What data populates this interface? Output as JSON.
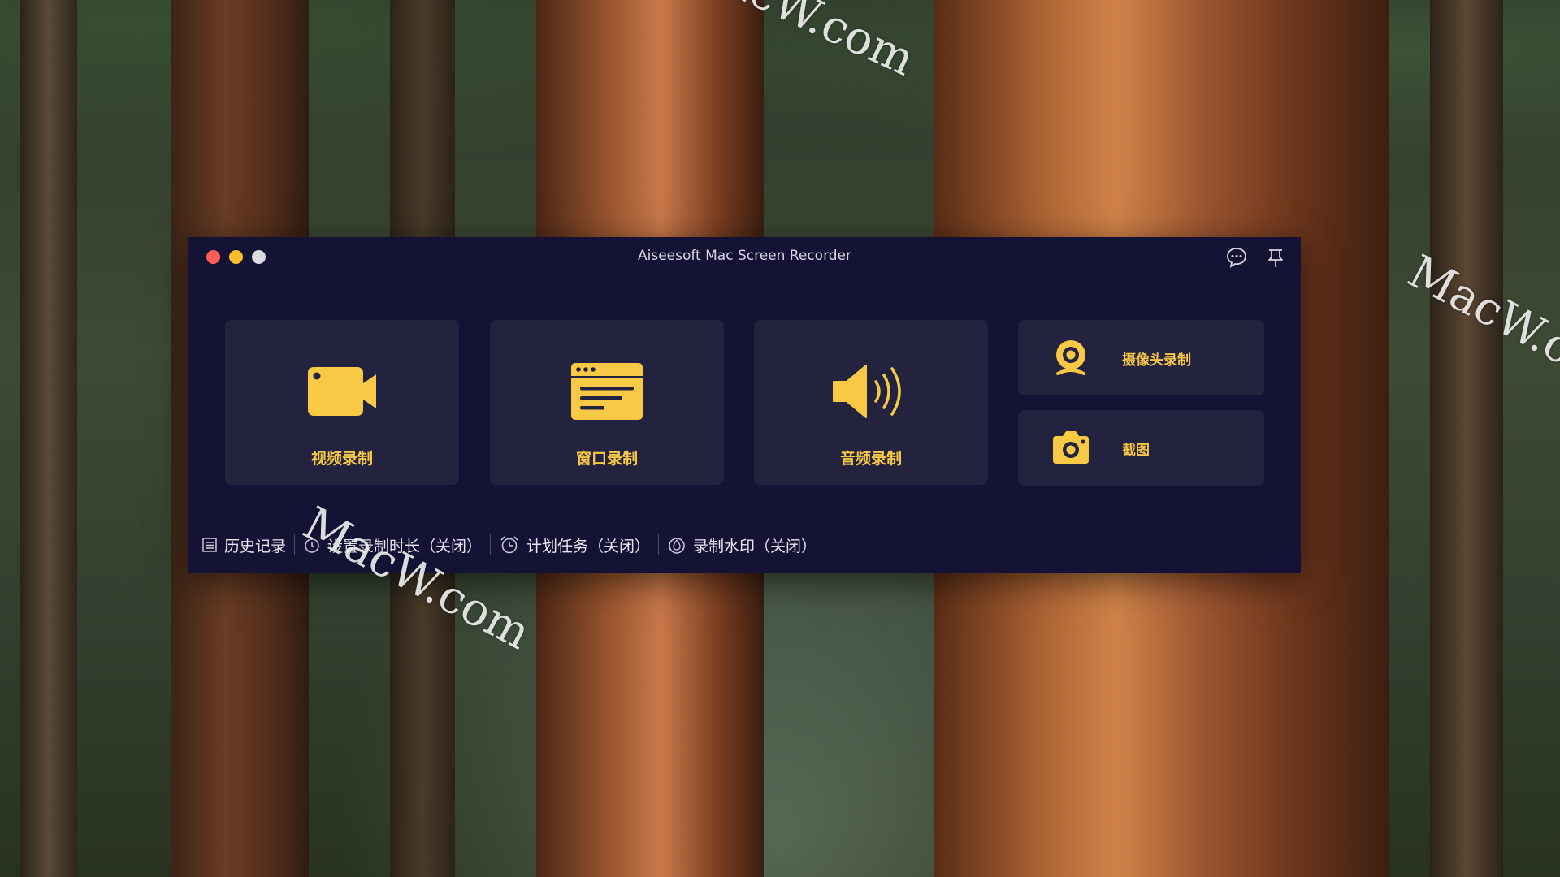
{
  "window": {
    "title": "Aiseesoft Mac Screen Recorder"
  },
  "titlebar_icons": [
    "feedback-icon",
    "pin-icon"
  ],
  "cards": {
    "video": {
      "label": "视频录制",
      "icon": "video-camera-icon"
    },
    "window": {
      "label": "窗口录制",
      "icon": "window-icon"
    },
    "audio": {
      "label": "音频录制",
      "icon": "speaker-icon"
    },
    "webcam": {
      "label": "摄像头录制",
      "icon": "webcam-icon"
    },
    "screenshot": {
      "label": "截图",
      "icon": "camera-icon"
    }
  },
  "bottom": {
    "history": "历史记录",
    "duration": "设置录制时长（关闭）",
    "schedule": "计划任务（关闭）",
    "watermark": "录制水印（关闭）"
  },
  "desktop": {
    "watermark_text": "MacW.com"
  },
  "colors": {
    "window_bg": "#141335",
    "card_bg": "#24233f",
    "accent": "#f7c944"
  }
}
